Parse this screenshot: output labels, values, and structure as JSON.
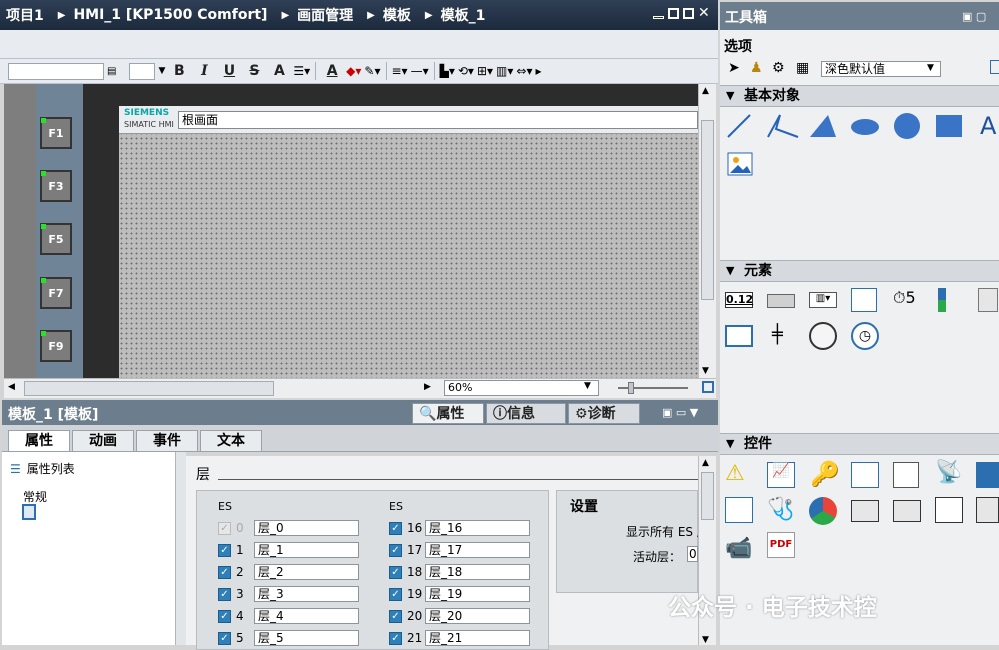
{
  "title_bar": {
    "crumbs": [
      "项目1",
      "HMI_1 [KP1500 Comfort]",
      "画面管理",
      "模板",
      "模板_1"
    ]
  },
  "toolbar": {
    "bold": "B",
    "italic": "I",
    "underline": "U",
    "strike": "S",
    "fontsize_a": "A",
    "fill_a": "A"
  },
  "function_keys": [
    "F1",
    "F3",
    "F5",
    "F7",
    "F9"
  ],
  "canvas": {
    "brand_line1": "SIEMENS",
    "brand_line2": "SIMATIC HMI",
    "screen_title": "根画面"
  },
  "zoom": {
    "value": "60%"
  },
  "properties": {
    "header": "模板_1 [模板]",
    "tabs": [
      "属性",
      "信息",
      "诊断"
    ],
    "subtabs": [
      "属性",
      "动画",
      "事件",
      "文本"
    ],
    "left_list": {
      "heading": "属性列表",
      "items": [
        "常规"
      ]
    },
    "section_title": "层",
    "es_left": "ES",
    "es_right": "ES",
    "layers_left": [
      {
        "num": "0",
        "name": "层_0"
      },
      {
        "num": "1",
        "name": "层_1"
      },
      {
        "num": "2",
        "name": "层_2"
      },
      {
        "num": "3",
        "name": "层_3"
      },
      {
        "num": "4",
        "name": "层_4"
      },
      {
        "num": "5",
        "name": "层_5"
      }
    ],
    "layers_right": [
      {
        "num": "16",
        "name": "层_16"
      },
      {
        "num": "17",
        "name": "层_17"
      },
      {
        "num": "18",
        "name": "层_18"
      },
      {
        "num": "19",
        "name": "层_19"
      },
      {
        "num": "20",
        "name": "层_20"
      },
      {
        "num": "21",
        "name": "层_21"
      }
    ],
    "settings": {
      "title": "设置",
      "show_all": "显示所有 ES 层",
      "active_layer": "活动层：",
      "active_value": "0"
    }
  },
  "toolbox": {
    "title": "工具箱",
    "options_label": "选项",
    "style_select": "深色默认值",
    "sections": [
      "基本对象",
      "元素",
      "控件"
    ],
    "io_text": "0.12",
    "clock_num": "5",
    "pdf": "PDF",
    "text_tool": "A"
  },
  "watermark": "公众号 · 电子技术控"
}
